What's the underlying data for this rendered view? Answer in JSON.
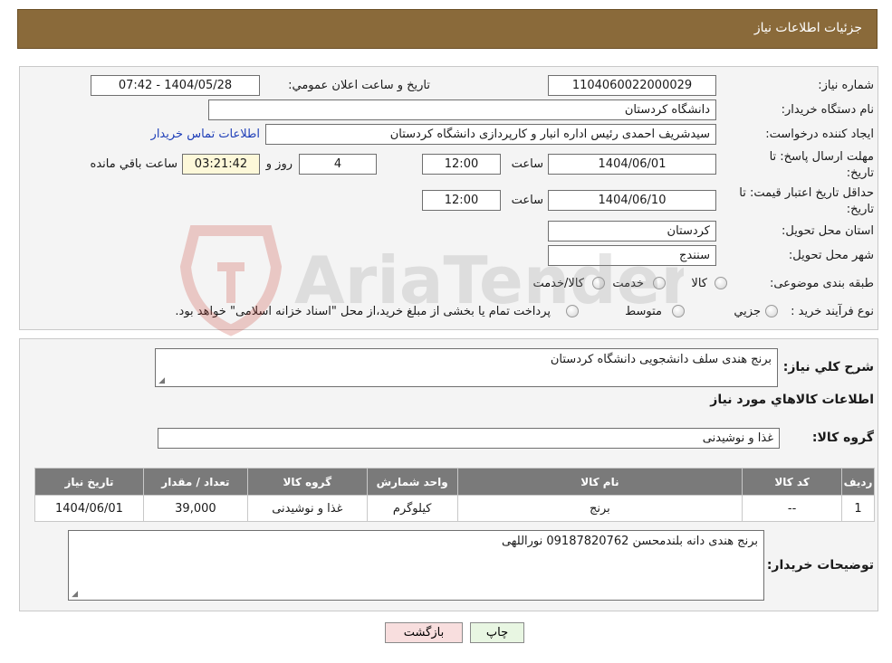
{
  "header": {
    "title": "جزئیات اطلاعات نیاز"
  },
  "form": {
    "need_number_label": "شماره نیاز:",
    "need_number": "1104060022000029",
    "announce_label": "تاریخ و ساعت اعلان عمومي:",
    "announce_value": "1404/05/28 - 07:42",
    "buyer_org_label": "نام دستگاه خریدار:",
    "buyer_org": "دانشگاه کردستان",
    "creator_label": "ایجاد کننده درخواست:",
    "creator": "سیدشریف احمدی رئیس اداره انبار و کارپردازی دانشگاه کردستان",
    "contact_link": "اطلاعات تماس خریدار",
    "deadline_label_1": "مهلت ارسال پاسخ: تا",
    "deadline_label_2": "تاریخ:",
    "deadline_date": "1404/06/01",
    "time_label": "ساعت",
    "deadline_time": "12:00",
    "days_value": "4",
    "days_label": "روز و",
    "remaining_time": "03:21:42",
    "remaining_label": "ساعت باقي مانده",
    "validity_label_1": "حداقل تاریخ اعتبار قیمت: تا",
    "validity_label_2": "تاریخ:",
    "validity_date": "1404/06/10",
    "validity_time": "12:00",
    "province_label": "استان محل تحویل:",
    "province": "کردستان",
    "city_label": "شهر محل تحویل:",
    "city": "سنندج",
    "category_label": "طبقه بندی موضوعی:",
    "category_options": [
      "کالا",
      "خدمت",
      "کالا/خدمت"
    ],
    "process_label": "نوع فرآیند خرید :",
    "process_options": [
      "جزیي",
      "متوسط"
    ],
    "process_note": "پرداخت تمام یا بخشی از مبلغ خرید،از محل \"اسناد خزانه اسلامی\" خواهد بود."
  },
  "details": {
    "summary_label": "شرح کلي نیاز:",
    "summary": "برنج هندی سلف دانشجویی دانشگاه کردستان",
    "goods_info_title": "اطلاعات کالاهاي مورد نیاز",
    "goods_group_label": "گروه کالا:",
    "goods_group": "غذا و نوشیدنی",
    "buyer_notes_label": "توضیحات خریدار:",
    "buyer_notes": "برنج هندی دانه بلندمحسن 09187820762 نوراللهی"
  },
  "table": {
    "headers": [
      "ردیف",
      "کد کالا",
      "نام کالا",
      "واحد شمارش",
      "گروه کالا",
      "تعداد / مقدار",
      "تاریخ نیاز"
    ],
    "rows": [
      [
        "1",
        "--",
        "برنج",
        "کیلوگرم",
        "غذا و نوشیدنی",
        "39,000",
        "1404/06/01"
      ]
    ]
  },
  "buttons": {
    "print": "چاپ",
    "back": "بازگشت"
  },
  "watermark": {
    "text": "AriaTender.neT"
  },
  "colors": {
    "header": "#8a6a3a",
    "link": "#1f3fb8",
    "back_button": "#f8dede",
    "print_button": "#e8f6e2"
  }
}
